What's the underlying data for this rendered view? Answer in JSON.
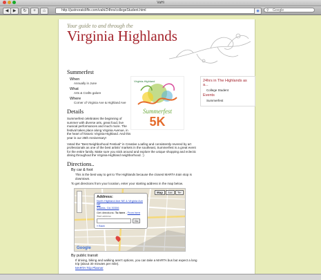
{
  "window": {
    "title": "VaHi"
  },
  "toolbar": {
    "url": "http://justnoratcliffe.com/vahi/24hrs/collegeStudent.html",
    "search_placeholder": "Google",
    "back_icon": "back-arrow-icon",
    "forward_icon": "forward-arrow-icon",
    "add_icon": "plus-icon",
    "home_icon": "home-icon",
    "reload_icon": "reload-icon"
  },
  "site": {
    "tagline": "Your guide to and through the",
    "title": "Virginia Highlands"
  },
  "event": {
    "heading": "Summerfest",
    "when_label": "When",
    "when_value": "Annually in June",
    "what_label": "What",
    "what_value": "Arts & Crafts galore",
    "where_label": "Where",
    "where_value": "Corner of Virginia Ave & Highland Ave"
  },
  "poster": {
    "top_text": "Virginia-Highland",
    "mid_text": "Summerfest",
    "big_text": "5K"
  },
  "details": {
    "heading": "Details",
    "p1": "Summerfest celebrates the beginning of summer with diverse arts, great food, live musical performances and much more. The festival takes place along Virginia Avenue, in the heart of historic Virginia-Highland. And this year is our 25th Anniversary!",
    "p2": "Voted the \"Best Neighborhood Festival\" in Creative Loafing and consistently revered by art professionals as one of the best artists' markets in the southeast, Summerfest is a great event for the entire family. Make sure you stick around and explore the unique shopping and eclectic dining throughout the Virginia-Highland neighborhood. :)"
  },
  "directions": {
    "heading": "Directions..",
    "car_label": "By car & foot",
    "car_text": "This is the best way to get to The Highlands because the closest MARTA train stop is downtown.",
    "car_text2": "To get directions from your location, enter your starting address in the map below.",
    "transit_label": "By public transit",
    "transit_text": "If driving, biking and walking aren't options, you can take a MARTA bus but expect a long trip (about 30 minutes per mile).",
    "transit_link": "MARTA Trip Planner"
  },
  "map": {
    "btn_map": "Map",
    "btn_sat": "Sat",
    "btn_ter": "Ter",
    "address_label": "Address:",
    "address_line1": "North Highland Ave NE & Virginia Ave NE",
    "address_line2": "Atlanta, GA 30306",
    "get_dir": "Get directions:",
    "to_here": "To here",
    "from_here": "From here",
    "start_label": "Start address",
    "go_btn": "Go",
    "back_link": "« Back",
    "logo": "Google"
  },
  "sidebar": {
    "link1": "24hrs in The Highlands as a...",
    "item1": "College Student",
    "events_heading": "Events",
    "item2": "Summerfest"
  },
  "colors": {
    "accent": "#a3222a",
    "background": "#e8edb8"
  }
}
